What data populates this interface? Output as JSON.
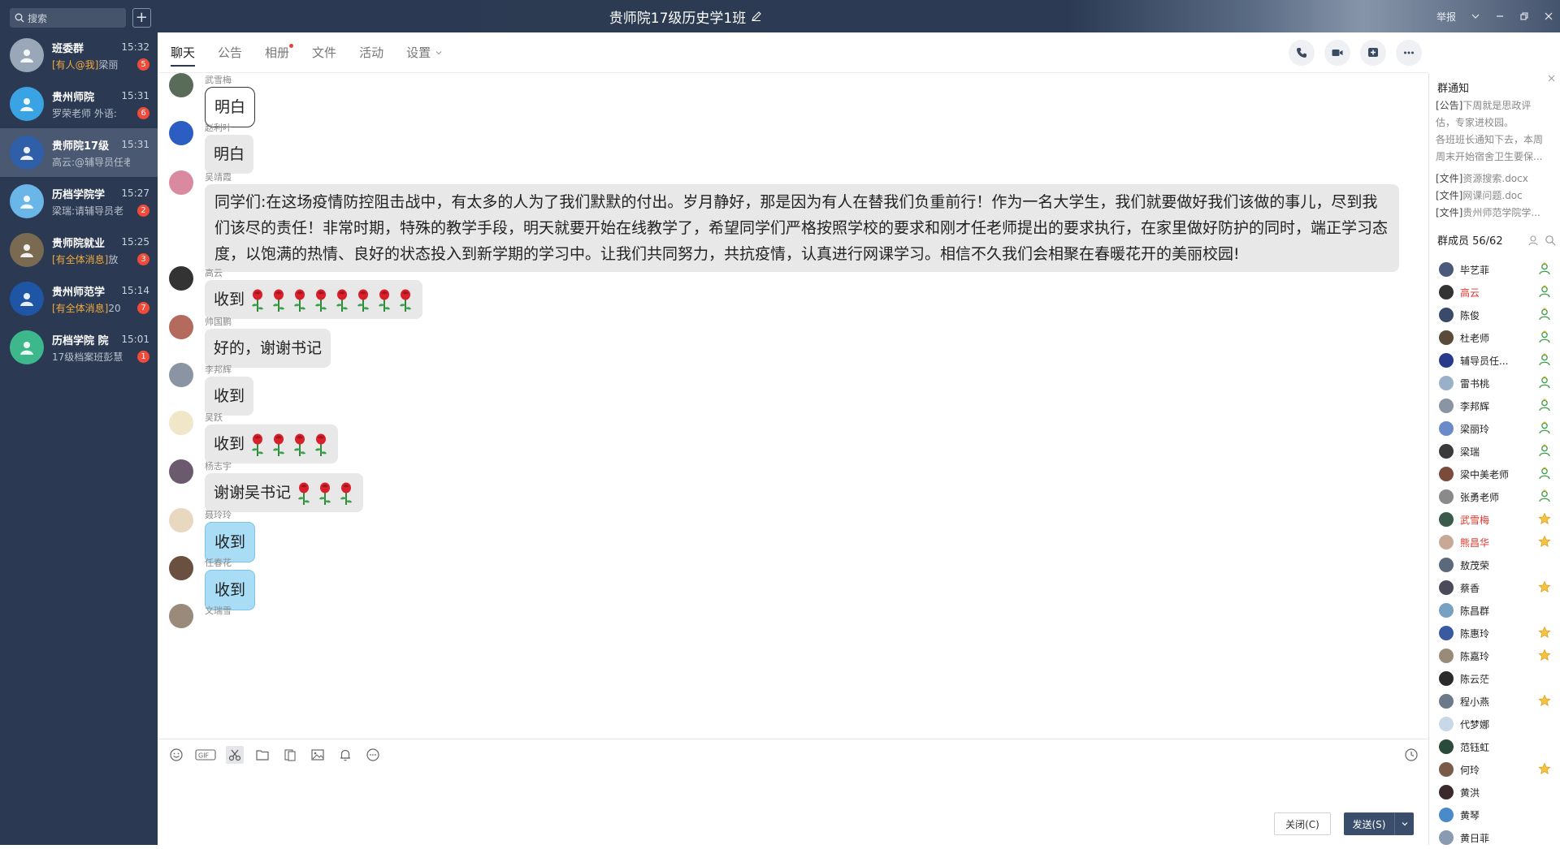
{
  "sidebar": {
    "search_placeholder": "搜索",
    "add_label": "+",
    "conversations": [
      {
        "name": "班委群",
        "time": "15:32",
        "tag": "[有人@我]",
        "preview": "梁丽",
        "badge": "5",
        "color": "#9aa7b8"
      },
      {
        "name": "贵州师院",
        "time": "15:31",
        "tag": "",
        "preview": "罗荣老师 外语:",
        "badge": "6",
        "color": "#3aa3e3"
      },
      {
        "name": "贵师院17级",
        "time": "15:31",
        "tag": "",
        "preview": "高云:@辅导员任老师",
        "badge": "",
        "color": "#2f5fa8"
      },
      {
        "name": "历档学院学",
        "time": "15:27",
        "tag": "",
        "preview": "梁瑞:请辅导员老",
        "badge": "2",
        "color": "#6bb6e8"
      },
      {
        "name": "贵师院就业",
        "time": "15:25",
        "tag": "[有全体消息]",
        "preview": "放",
        "badge": "3",
        "color": "#7a6a52"
      },
      {
        "name": "贵州师范学",
        "time": "15:14",
        "tag": "[有全体消息]",
        "preview": "20",
        "badge": "7",
        "color": "#1f55a5"
      },
      {
        "name": "历档学院 院",
        "time": "15:01",
        "tag": "",
        "preview": "17级档案班彭慧",
        "badge": "1",
        "color": "#3cb88c"
      }
    ]
  },
  "titlebar": {
    "title": "贵师院17级历史学1班",
    "report": "举报"
  },
  "tabs": {
    "items": [
      "聊天",
      "公告",
      "相册",
      "文件",
      "活动",
      "设置"
    ]
  },
  "messages": [
    {
      "sender": "武雪梅",
      "text": "明白",
      "style": "white",
      "roses": 0,
      "color": "#5b6b5a"
    },
    {
      "sender": "赵利叶",
      "text": "明白",
      "style": "gray",
      "roses": 0,
      "color": "#2c5dc2"
    },
    {
      "sender": "吴靖霞",
      "text": "同学们:在这场疫情防控阻击战中，有太多的人为了我们默默的付出。岁月静好，那是因为有人在替我们负重前行！作为一名大学生，我们就要做好我们该做的事儿，尽到我们该尽的责任！非常时期，特殊的教学手段，明天就要开始在线教学了，希望同学们严格按照学校的要求和刚才任老师提出的要求执行，在家里做好防护的同时，端正学习态度，以饱满的热情、良好的状态投入到新学期的学习中。让我们共同努力，共抗疫情，认真进行网课学习。相信不久我们会相聚在春暖花开的美丽校园!",
      "style": "long",
      "roses": 0,
      "color": "#d98aa0"
    },
    {
      "sender": "高云",
      "text": "收到",
      "style": "gray",
      "roses": 8,
      "color": "#333333"
    },
    {
      "sender": "帅国鹏",
      "text": "好的，谢谢书记",
      "style": "gray",
      "roses": 0,
      "color": "#b46a5c"
    },
    {
      "sender": "李邦辉",
      "text": "收到",
      "style": "gray",
      "roses": 0,
      "color": "#8a94a3"
    },
    {
      "sender": "吴跃",
      "text": "收到",
      "style": "gray",
      "roses": 4,
      "color": "#f0e6c8"
    },
    {
      "sender": "杨志宇",
      "text": "谢谢吴书记",
      "style": "gray",
      "roses": 3,
      "color": "#6b5a6e"
    },
    {
      "sender": "聂玲玲",
      "text": "收到",
      "style": "blue",
      "roses": 0,
      "color": "#e8d8c0"
    },
    {
      "sender": "任春花",
      "text": "收到",
      "style": "blue",
      "roses": 0,
      "color": "#6a5040"
    },
    {
      "sender": "文瑞雪",
      "text": "",
      "style": "none",
      "roses": 0,
      "color": "#9a8a7a"
    }
  ],
  "input": {
    "close_label": "关闭(C)",
    "send_label": "发送(S)"
  },
  "notice": {
    "title": "群通知",
    "announce_tag": "[公告]",
    "announce_line1": "下周就是思政评",
    "announce_line2": "估，专家进校园。",
    "announce_line3": "各班班长通知下去，本周",
    "announce_line4": "周末开始宿舍卫生要保...",
    "files": [
      {
        "tag": "[文件]",
        "name": "资源搜索.docx"
      },
      {
        "tag": "[文件]",
        "name": "网课问题.doc"
      },
      {
        "tag": "[文件]",
        "name": "贵州师范学院学..."
      }
    ]
  },
  "members": {
    "header": "群成员 56/62",
    "list": [
      {
        "name": "毕艺菲",
        "red": false,
        "role": "admin",
        "color": "#4a5a7a"
      },
      {
        "name": "高云",
        "red": true,
        "role": "admin",
        "color": "#333333"
      },
      {
        "name": "陈俊",
        "red": false,
        "role": "admin",
        "color": "#3a4a6a"
      },
      {
        "name": "杜老师",
        "red": false,
        "role": "admin",
        "color": "#5a4a3a"
      },
      {
        "name": "辅导员任...",
        "red": false,
        "role": "admin",
        "color": "#2a3a8a"
      },
      {
        "name": "雷书桃",
        "red": false,
        "role": "admin",
        "color": "#9ab0c8"
      },
      {
        "name": "李邦辉",
        "red": false,
        "role": "admin",
        "color": "#8a94a3"
      },
      {
        "name": "梁丽玲",
        "red": false,
        "role": "admin",
        "color": "#6a8ac8"
      },
      {
        "name": "梁瑞",
        "red": false,
        "role": "admin",
        "color": "#3a3a3a"
      },
      {
        "name": "梁中美老师",
        "red": false,
        "role": "admin",
        "color": "#7a4a3a"
      },
      {
        "name": "张勇老师",
        "red": false,
        "role": "admin",
        "color": "#8a8a8a"
      },
      {
        "name": "武雪梅",
        "red": true,
        "role": "star",
        "color": "#3a5a4a"
      },
      {
        "name": "熊昌华",
        "red": true,
        "role": "star",
        "color": "#c8a898"
      },
      {
        "name": "敖茂荣",
        "red": false,
        "role": "none",
        "color": "#5a6a7a"
      },
      {
        "name": "蔡香",
        "red": false,
        "role": "star",
        "color": "#4a4a5a"
      },
      {
        "name": "陈昌群",
        "red": false,
        "role": "none",
        "color": "#7aa0c0"
      },
      {
        "name": "陈惠玲",
        "red": false,
        "role": "star",
        "color": "#3a5aa0"
      },
      {
        "name": "陈嘉玲",
        "red": false,
        "role": "star",
        "color": "#9a8a7a"
      },
      {
        "name": "陈云茫",
        "red": false,
        "role": "none",
        "color": "#2a2a2a"
      },
      {
        "name": "程小燕",
        "red": false,
        "role": "star",
        "color": "#6a7a8a"
      },
      {
        "name": "代梦娜",
        "red": false,
        "role": "none",
        "color": "#c8d8e8"
      },
      {
        "name": "范钰虹",
        "red": false,
        "role": "none",
        "color": "#2a4a3a"
      },
      {
        "name": "何玲",
        "red": false,
        "role": "star",
        "color": "#7a5a4a"
      },
      {
        "name": "黄洪",
        "red": false,
        "role": "none",
        "color": "#3a2a2a"
      },
      {
        "name": "黄琴",
        "red": false,
        "role": "none",
        "color": "#4a8ac8"
      },
      {
        "name": "黄日菲",
        "red": false,
        "role": "none",
        "color": "#8a9ab0"
      }
    ]
  }
}
